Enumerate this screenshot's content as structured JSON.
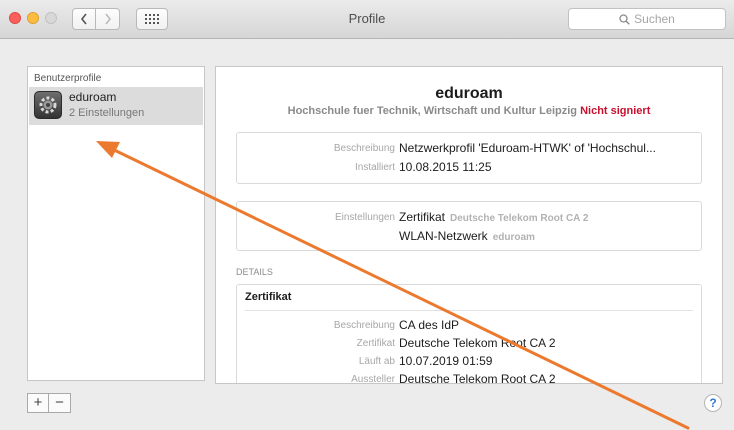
{
  "window": {
    "title": "Profile",
    "search_placeholder": "Suchen"
  },
  "sidebar": {
    "header": "Benutzerprofile",
    "profiles": [
      {
        "name": "eduroam",
        "count": "2 Einstellungen"
      }
    ],
    "add_label": "+",
    "remove_label": "−"
  },
  "profile": {
    "name": "eduroam",
    "organization": "Hochschule fuer Technik, Wirtschaft und Kultur Leipzig",
    "signature_status": "Nicht signiert",
    "beschreibung_label": "Beschreibung",
    "beschreibung_value": "Netzwerkprofil 'Eduroam-HTWK' of 'Hochschul...",
    "installiert_label": "Installiert",
    "installiert_value": "10.08.2015 11:25",
    "einstellungen_label": "Einstellungen",
    "einstellungen": [
      {
        "type": "Zertifikat",
        "detail": "Deutsche Telekom Root CA 2"
      },
      {
        "type": "WLAN-Netzwerk",
        "detail": "eduroam"
      }
    ]
  },
  "details": {
    "label": "DETAILS",
    "section_title": "Zertifikat",
    "rows": [
      {
        "label": "Beschreibung",
        "value": "CA des IdP"
      },
      {
        "label": "Zertifikat",
        "value": "Deutsche Telekom Root CA 2"
      },
      {
        "label": "Läuft ab",
        "value": "10.07.2019 01:59"
      },
      {
        "label": "Aussteller",
        "value": "Deutsche Telekom Root CA 2"
      }
    ]
  },
  "help_label": "?",
  "colors": {
    "unsigned": "#c8102e",
    "annotation_arrow": "#ec7a2e",
    "selected_row": "#dcdcdc"
  }
}
